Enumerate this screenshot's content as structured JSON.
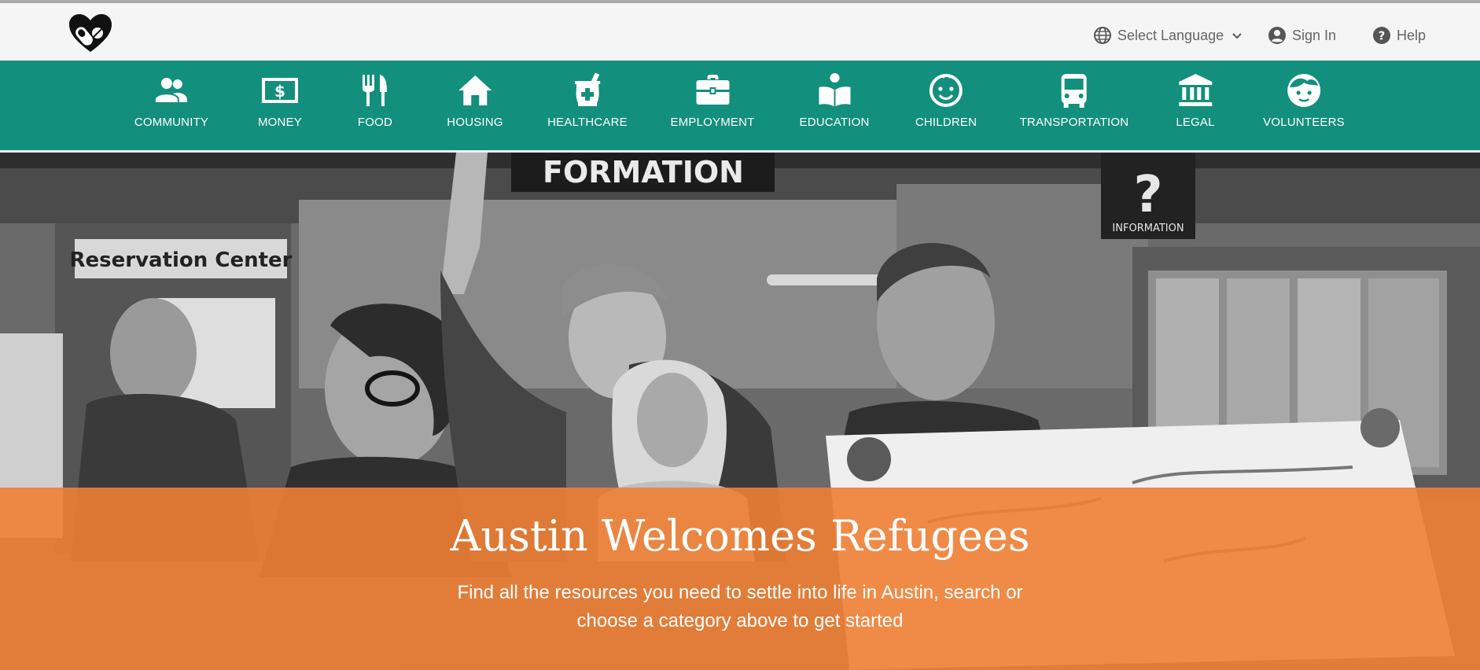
{
  "header": {
    "logo_icon": "heart-with-pills-logo",
    "language_label": "Select Language",
    "signin_label": "Sign In",
    "help_label": "Help"
  },
  "nav": {
    "background": "#138f7d",
    "items": [
      {
        "label": "COMMUNITY",
        "icon": "people-icon"
      },
      {
        "label": "MONEY",
        "icon": "money-icon"
      },
      {
        "label": "FOOD",
        "icon": "fork-knife-icon"
      },
      {
        "label": "HOUSING",
        "icon": "house-icon"
      },
      {
        "label": "HEALTHCARE",
        "icon": "mortar-pestle-icon"
      },
      {
        "label": "EMPLOYMENT",
        "icon": "briefcase-icon"
      },
      {
        "label": "EDUCATION",
        "icon": "reading-icon"
      },
      {
        "label": "CHILDREN",
        "icon": "child-face-icon"
      },
      {
        "label": "TRANSPORTATION",
        "icon": "bus-icon"
      },
      {
        "label": "LEGAL",
        "icon": "courthouse-icon"
      },
      {
        "label": "VOLUNTEERS",
        "icon": "volunteer-face-icon"
      }
    ]
  },
  "hero": {
    "sign_reservation": "Reservation Center",
    "sign_information": "INFORMATION",
    "sign_formation": "FORMATION",
    "banner_color": "#ee8034",
    "title": "Austin Welcomes Refugees",
    "subtitle": "Find all the resources you need to settle into life in Austin, search or choose a category above to get started"
  }
}
